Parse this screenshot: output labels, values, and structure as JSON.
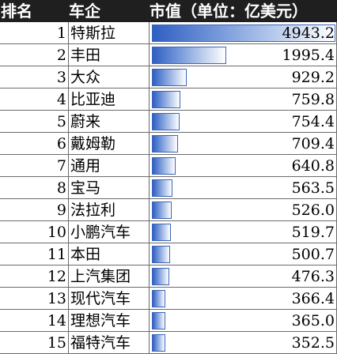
{
  "header": {
    "rank": "排名",
    "company": "车企",
    "value": "市值（单位：亿美元）"
  },
  "rows": [
    {
      "rank": "1",
      "company": "特斯拉",
      "value": "4943.2"
    },
    {
      "rank": "2",
      "company": "丰田",
      "value": "1995.4"
    },
    {
      "rank": "3",
      "company": "大众",
      "value": "929.2"
    },
    {
      "rank": "4",
      "company": "比亚迪",
      "value": "759.8"
    },
    {
      "rank": "5",
      "company": "蔚来",
      "value": "754.4"
    },
    {
      "rank": "6",
      "company": "戴姆勒",
      "value": "709.4"
    },
    {
      "rank": "7",
      "company": "通用",
      "value": "640.8"
    },
    {
      "rank": "8",
      "company": "宝马",
      "value": "563.5"
    },
    {
      "rank": "9",
      "company": "法拉利",
      "value": "526.0"
    },
    {
      "rank": "10",
      "company": "小鹏汽车",
      "value": "519.7"
    },
    {
      "rank": "11",
      "company": "本田",
      "value": "500.7"
    },
    {
      "rank": "12",
      "company": "上汽集团",
      "value": "476.3"
    },
    {
      "rank": "13",
      "company": "现代汽车",
      "value": "366.4"
    },
    {
      "rank": "14",
      "company": "理想汽车",
      "value": "365.0"
    },
    {
      "rank": "15",
      "company": "福特汽车",
      "value": "352.5"
    }
  ],
  "colors": {
    "header_bg": "#1f1f1f",
    "header_text": "#ffffff",
    "bar_fill": "#2f5fc4",
    "bar_border": "#3a66b8",
    "grid": "#6a6a6a"
  }
}
